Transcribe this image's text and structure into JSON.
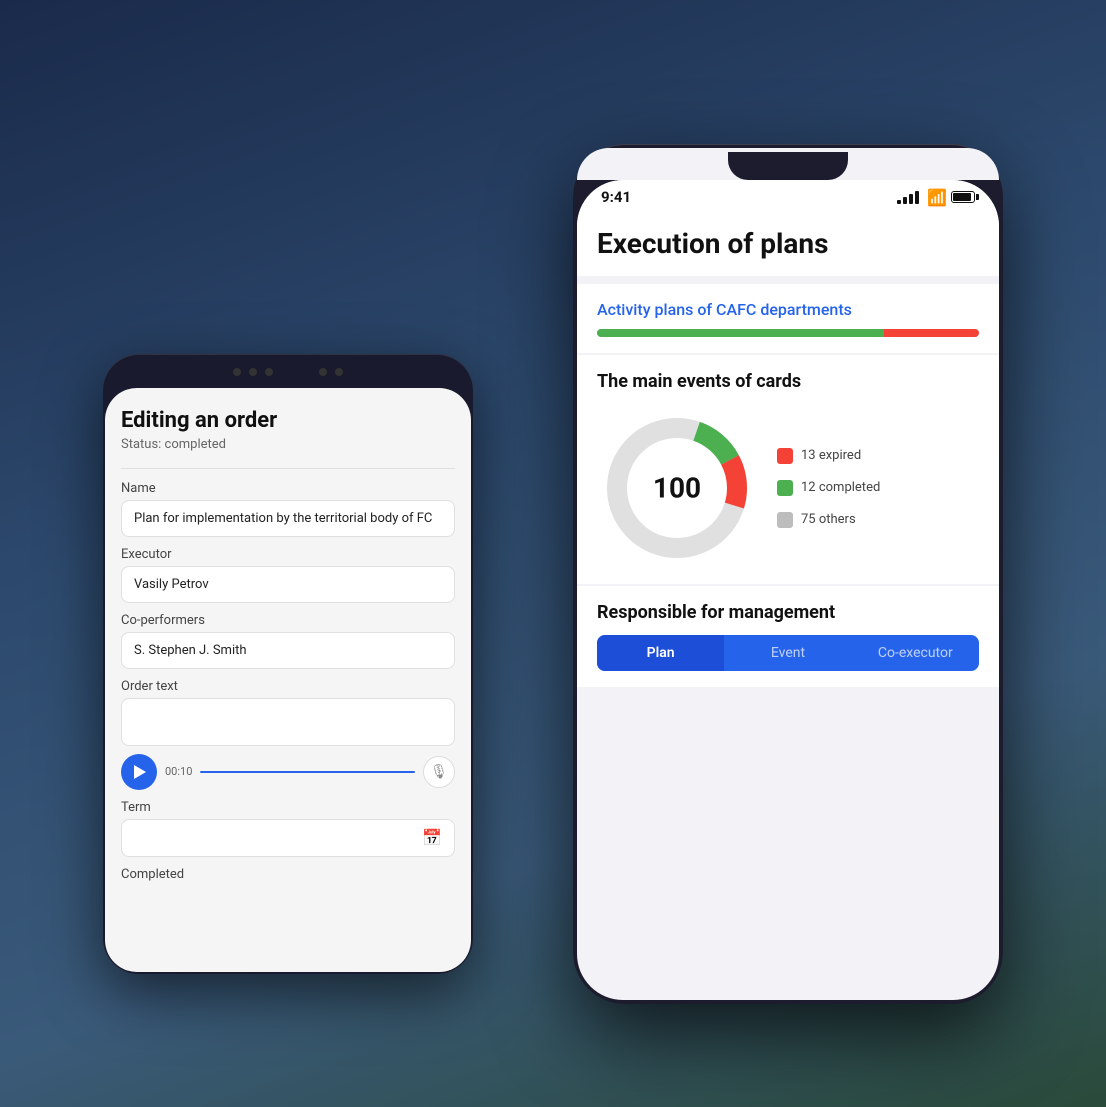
{
  "background": {
    "gradient_start": "#1a2a4a",
    "gradient_end": "#2a4a3a"
  },
  "android": {
    "title": "Editing an order",
    "status": "Status: completed",
    "name_label": "Name",
    "name_value": "Plan for implementation by the territorial body of FC",
    "executor_label": "Executor",
    "executor_value": "Vasily Petrov",
    "coperformers_label": "Co-performers",
    "coperformers_value": "S. Stephen  J. Smith",
    "order_text_label": "Order text",
    "audio_time": "00:10",
    "term_label": "Term",
    "completed_label": "Completed"
  },
  "iphone": {
    "status_time": "9:41",
    "title": "Execution of plans",
    "activity_title": "Activity plans of CAFC departments",
    "progress_green_pct": 75,
    "progress_red_pct": 25,
    "main_events_title": "The main events of cards",
    "donut_center": "100",
    "legend": [
      {
        "color": "#f44336",
        "label": "13 expired"
      },
      {
        "color": "#4caf50",
        "label": "12 completed"
      },
      {
        "color": "#bdbdbd",
        "label": "75 others"
      }
    ],
    "responsible_title": "Responsible for management",
    "tabs": [
      {
        "label": "Plan",
        "active": true
      },
      {
        "label": "Event",
        "active": false
      },
      {
        "label": "Co-executor",
        "active": false
      }
    ]
  }
}
